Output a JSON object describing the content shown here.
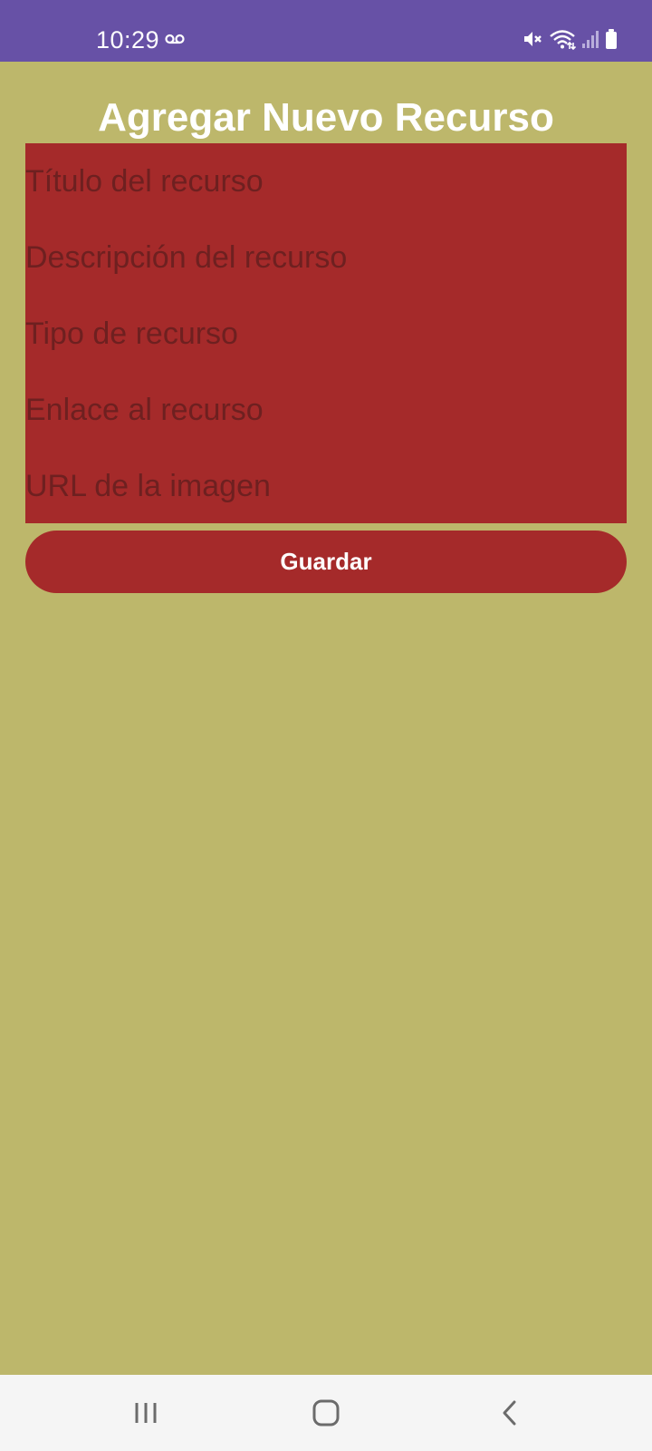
{
  "status_bar": {
    "time": "10:29",
    "icons": [
      "voicemail-icon",
      "mute-icon",
      "wifi-icon",
      "signal-icon",
      "battery-icon"
    ]
  },
  "colors": {
    "status_bar": "#6751a6",
    "background": "#bdb76b",
    "panel": "#a52a2a",
    "title": "#ffffff"
  },
  "page": {
    "title": "Agregar Nuevo Recurso"
  },
  "form": {
    "fields": [
      {
        "placeholder": "Título del recurso",
        "value": ""
      },
      {
        "placeholder": "Descripción del recurso",
        "value": ""
      },
      {
        "placeholder": "Tipo de recurso",
        "value": ""
      },
      {
        "placeholder": "Enlace al recurso",
        "value": ""
      },
      {
        "placeholder": "URL de la imagen",
        "value": ""
      }
    ],
    "save_label": "Guardar"
  },
  "nav_bar": {
    "icons": [
      "recent-apps-icon",
      "home-icon",
      "back-icon"
    ]
  }
}
